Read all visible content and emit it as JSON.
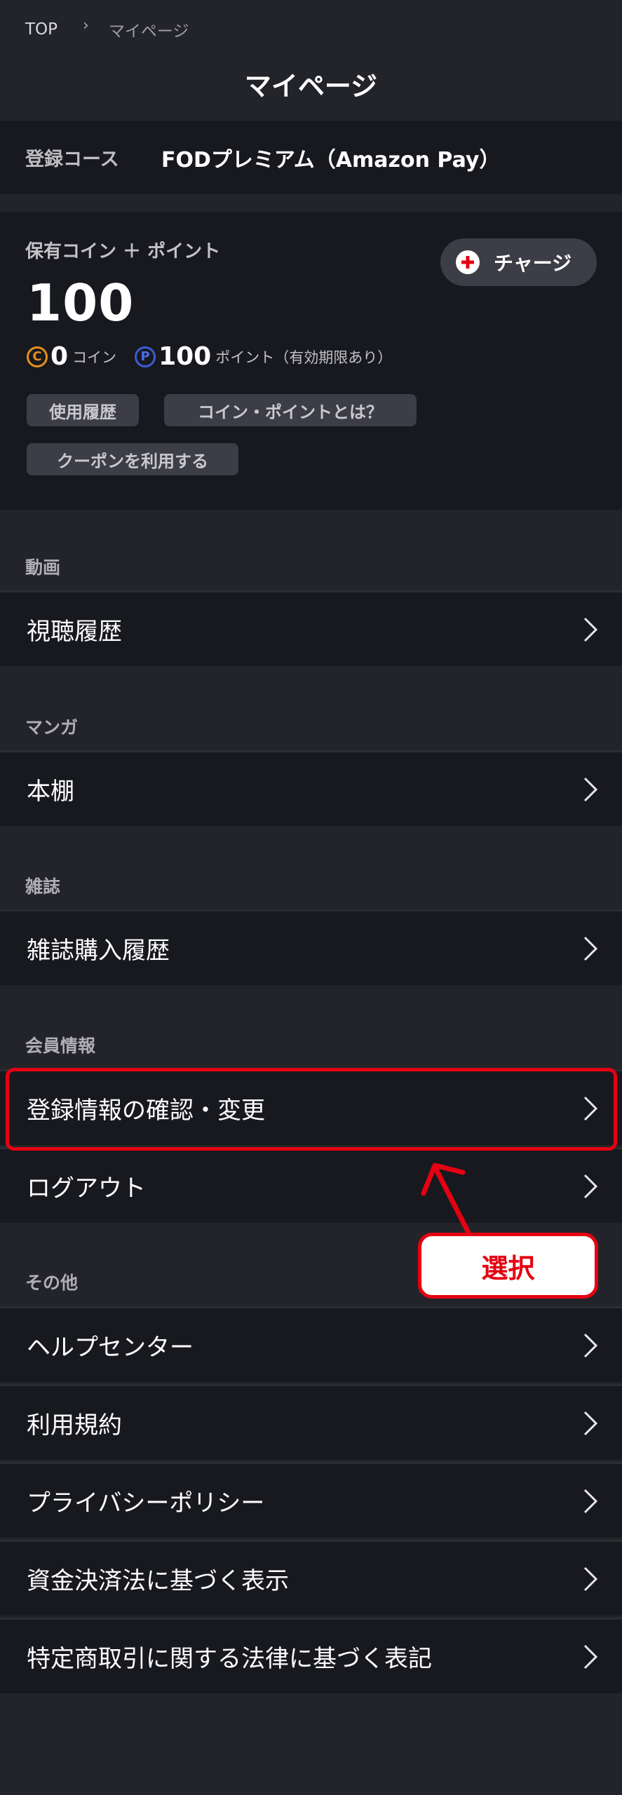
{
  "breadcrumb": {
    "top": "TOP",
    "current": "マイページ"
  },
  "page_title": "マイページ",
  "course": {
    "label": "登録コース",
    "value": "FODプレミアム（Amazon Pay）"
  },
  "coins": {
    "heading": "保有コイン ＋ ポイント",
    "total": "100",
    "charge_label": "チャージ",
    "coin_badge": "C",
    "coin_value": "0",
    "coin_unit": "コイン",
    "point_badge": "P",
    "point_value": "100",
    "point_unit": "ポイント（有効期限あり）",
    "chips": [
      "使用履歴",
      "コイン・ポイントとは？",
      "クーポンを利用する"
    ]
  },
  "sections": [
    {
      "label": "動画",
      "items": [
        "視聴履歴"
      ]
    },
    {
      "label": "マンガ",
      "items": [
        "本棚"
      ]
    },
    {
      "label": "雑誌",
      "items": [
        "雑誌購入履歴"
      ]
    },
    {
      "label": "会員情報",
      "items": [
        "登録情報の確認・変更",
        "ログアウト"
      ]
    },
    {
      "label": "その他",
      "items": [
        "ヘルプセンター",
        "利用規約",
        "プライバシーポリシー",
        "資金決済法に基づく表示",
        "特定商取引に関する法律に基づく表記"
      ]
    }
  ],
  "annotation": {
    "callout": "選択",
    "color": "#e50012"
  },
  "colors": {
    "background": "#23242a",
    "panel": "#18191e",
    "accent": "#e50012"
  }
}
